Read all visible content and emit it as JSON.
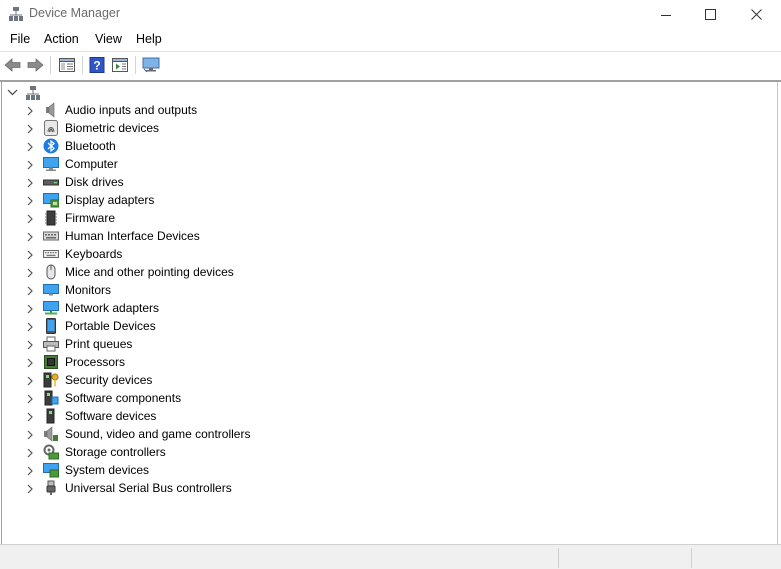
{
  "window": {
    "title": "Device Manager"
  },
  "menu": [
    "File",
    "Action",
    "View",
    "Help"
  ],
  "toolbar": {
    "buttons": [
      "back-icon",
      "forward-icon",
      "show-hide-console-tree-icon",
      "help-icon",
      "action-pane-icon",
      "monitor-icon"
    ]
  },
  "tree": {
    "root_icon": "computer-network-icon",
    "root_label": "",
    "categories": [
      {
        "label": "Audio inputs and outputs",
        "icon": "speaker-icon"
      },
      {
        "label": "Biometric devices",
        "icon": "fingerprint-icon"
      },
      {
        "label": "Bluetooth",
        "icon": "bluetooth-icon"
      },
      {
        "label": "Computer",
        "icon": "computer-icon"
      },
      {
        "label": "Disk drives",
        "icon": "disk-drive-icon"
      },
      {
        "label": "Display adapters",
        "icon": "display-adapter-icon"
      },
      {
        "label": "Firmware",
        "icon": "firmware-icon"
      },
      {
        "label": "Human Interface Devices",
        "icon": "hid-icon"
      },
      {
        "label": "Keyboards",
        "icon": "keyboard-icon"
      },
      {
        "label": "Mice and other pointing devices",
        "icon": "mouse-icon"
      },
      {
        "label": "Monitors",
        "icon": "monitor-icon"
      },
      {
        "label": "Network adapters",
        "icon": "network-adapter-icon"
      },
      {
        "label": "Portable Devices",
        "icon": "portable-device-icon"
      },
      {
        "label": "Print queues",
        "icon": "printer-icon"
      },
      {
        "label": "Processors",
        "icon": "processor-icon"
      },
      {
        "label": "Security devices",
        "icon": "security-key-icon"
      },
      {
        "label": "Software components",
        "icon": "software-component-icon"
      },
      {
        "label": "Software devices",
        "icon": "software-device-icon"
      },
      {
        "label": "Sound, video and game controllers",
        "icon": "sound-icon"
      },
      {
        "label": "Storage controllers",
        "icon": "storage-controller-icon"
      },
      {
        "label": "System devices",
        "icon": "system-device-icon"
      },
      {
        "label": "Universal Serial Bus controllers",
        "icon": "usb-icon"
      }
    ]
  },
  "colors": {
    "accent_blue": "#1e88e5",
    "chrome_border": "#a0a0a0",
    "status_bg": "#f0f0f0"
  }
}
